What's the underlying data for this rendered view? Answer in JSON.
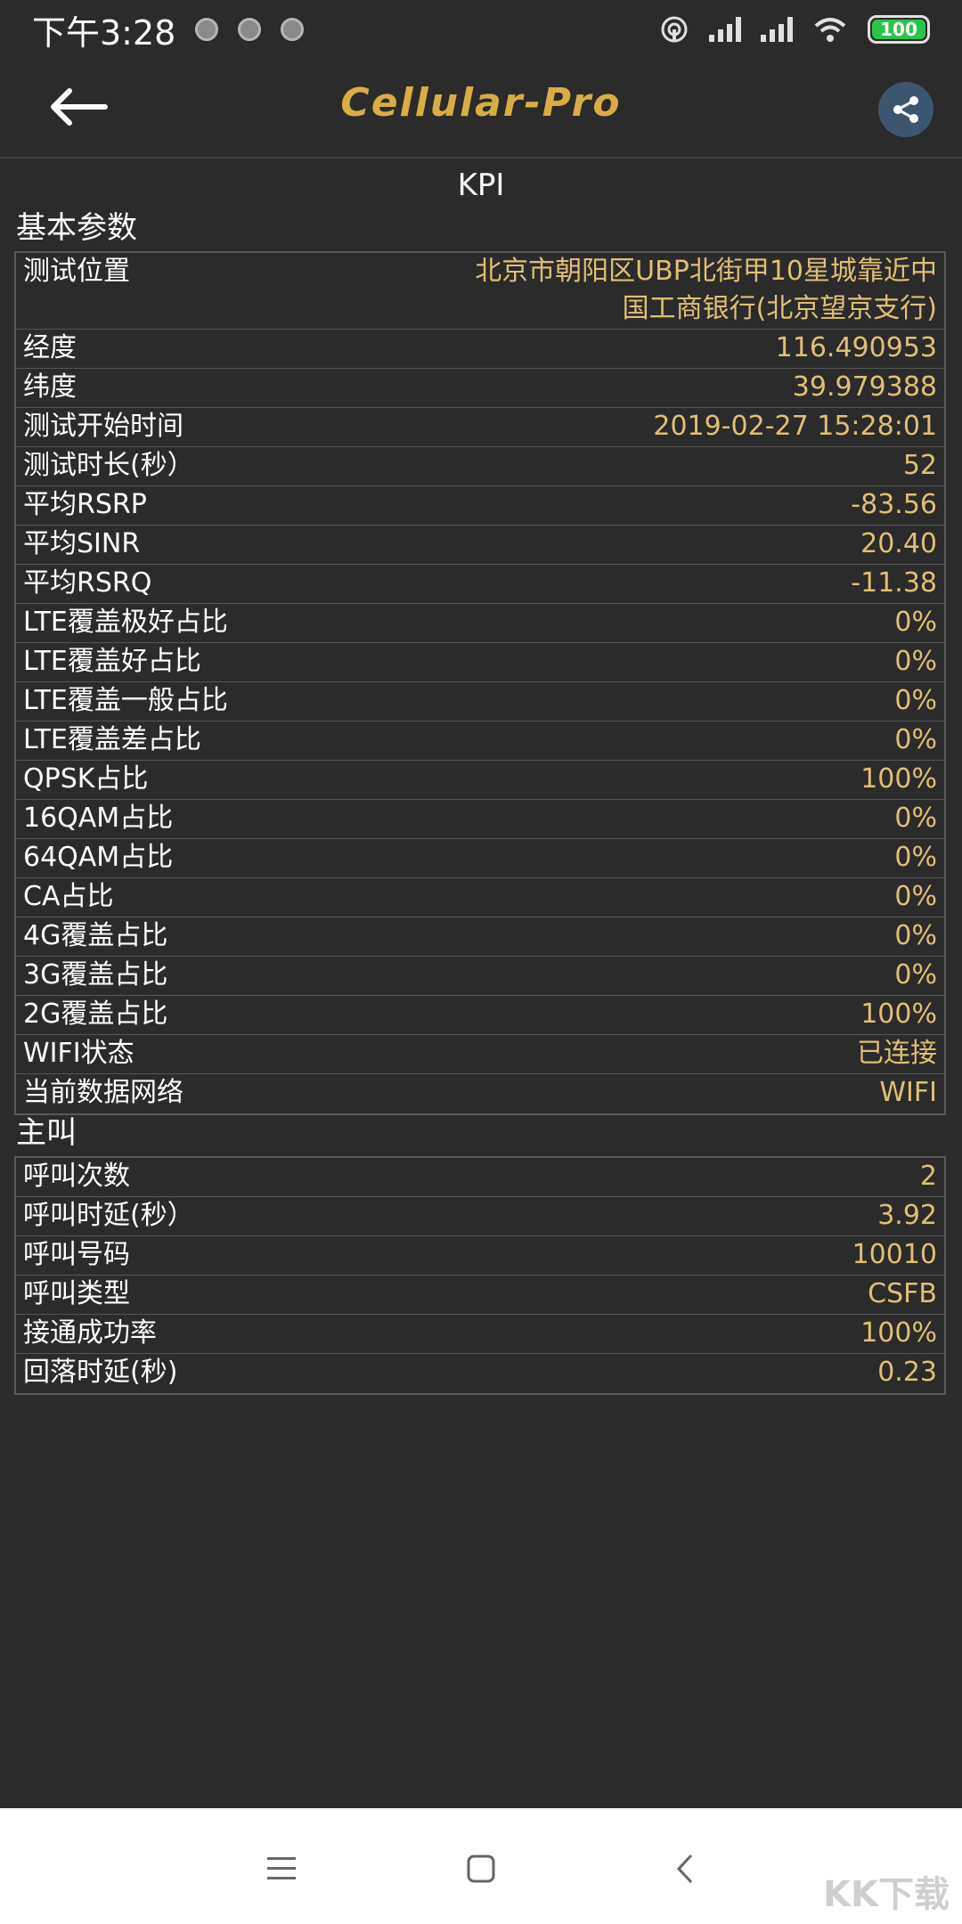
{
  "status_bar": {
    "time": "下午3:28",
    "battery": "100",
    "battery_color": "#29c54a"
  },
  "app_bar": {
    "back_icon": "arrow-left-icon",
    "title": "Cellular-Pro",
    "share_icon": "share-icon",
    "title_color": "#d8ad45"
  },
  "page": {
    "title": "KPI"
  },
  "sections": [
    {
      "title": "基本参数",
      "rows": [
        {
          "label": "测试位置",
          "value": "北京市朝阳区UBP北街甲10星城靠近中国工商银行(北京望京支行)"
        },
        {
          "label": "经度",
          "value": "116.490953"
        },
        {
          "label": "纬度",
          "value": "39.979388"
        },
        {
          "label": "测试开始时间",
          "value": "2019-02-27  15:28:01"
        },
        {
          "label": "测试时长(秒）",
          "value": "52"
        },
        {
          "label": "平均RSRP",
          "value": "-83.56"
        },
        {
          "label": "平均SINR",
          "value": "20.40"
        },
        {
          "label": "平均RSRQ",
          "value": "-11.38"
        },
        {
          "label": "LTE覆盖极好占比",
          "value": "0%"
        },
        {
          "label": "LTE覆盖好占比",
          "value": "0%"
        },
        {
          "label": "LTE覆盖一般占比",
          "value": "0%"
        },
        {
          "label": "LTE覆盖差占比",
          "value": "0%"
        },
        {
          "label": "QPSK占比",
          "value": "100%"
        },
        {
          "label": "16QAM占比",
          "value": "0%"
        },
        {
          "label": "64QAM占比",
          "value": "0%"
        },
        {
          "label": "CA占比",
          "value": "0%"
        },
        {
          "label": "4G覆盖占比",
          "value": "0%"
        },
        {
          "label": "3G覆盖占比",
          "value": "0%"
        },
        {
          "label": "2G覆盖占比",
          "value": "100%"
        },
        {
          "label": "WIFI状态",
          "value": "已连接"
        },
        {
          "label": "当前数据网络",
          "value": "WIFI"
        }
      ]
    },
    {
      "title": "主叫",
      "rows": [
        {
          "label": "呼叫次数",
          "value": "2"
        },
        {
          "label": "呼叫时延(秒）",
          "value": "3.92"
        },
        {
          "label": "呼叫号码",
          "value": "10010"
        },
        {
          "label": "呼叫类型",
          "value": "CSFB"
        },
        {
          "label": "接通成功率",
          "value": "100%"
        },
        {
          "label": "回落时延(秒)",
          "value": "0.23"
        }
      ]
    }
  ],
  "nav_bar": {
    "menu_icon": "menu-icon",
    "home_icon": "home-square-icon",
    "back_icon": "back-chevron-icon"
  },
  "watermark": "KK下载",
  "colors": {
    "background": "#2b2b2b",
    "value": "#e0bf75",
    "border": "#5a5a5a"
  }
}
